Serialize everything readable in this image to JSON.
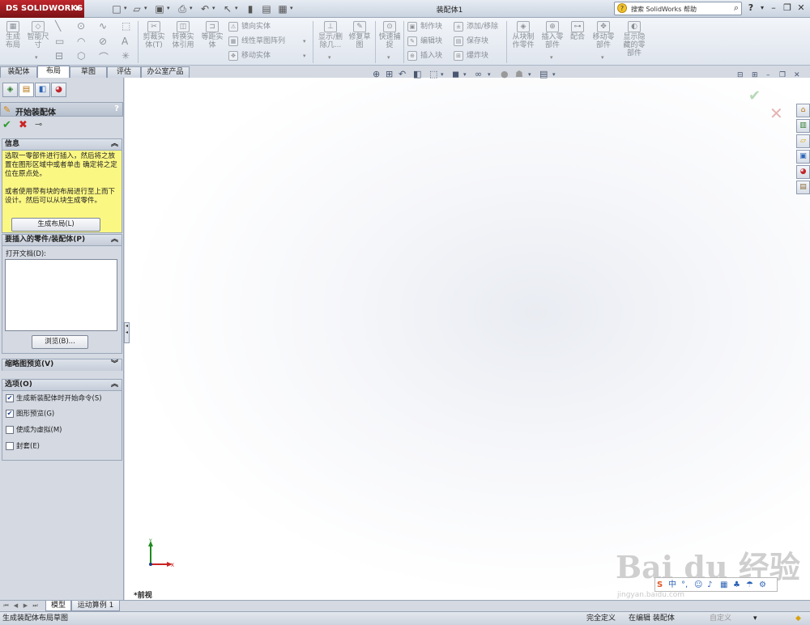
{
  "app": {
    "logo": "SOLIDWORKS",
    "logo_prefix": "DS",
    "doc_title": "装配体1",
    "search_placeholder": "搜索 SolidWorks 帮助",
    "help_icon": "?"
  },
  "ribbon": {
    "sketch": [
      {
        "label": "生成\n布局",
        "icon": "layout-icon"
      },
      {
        "label": "智能尺\n寸",
        "icon": "smart-dimension-icon"
      }
    ],
    "edit": [
      {
        "label": "剪裁实\n体(T)"
      },
      {
        "label": "转换实\n体引用"
      },
      {
        "label": "等距实\n体"
      }
    ],
    "edit_small": [
      {
        "label": "镜向实体"
      },
      {
        "label": "线性草图阵列"
      },
      {
        "label": "移动实体"
      }
    ],
    "display": [
      {
        "label": "显示/删\n除几..."
      },
      {
        "label": "修复草\n图"
      },
      {
        "label": "快速捕\n捉"
      }
    ],
    "block_small": [
      {
        "label": "制作块"
      },
      {
        "label": "编辑块"
      },
      {
        "label": "插入块"
      }
    ],
    "block_small2": [
      {
        "label": "添加/移除"
      },
      {
        "label": "保存块"
      },
      {
        "label": "爆炸块"
      }
    ],
    "assembly": [
      {
        "label": "从块制\n作零件"
      },
      {
        "label": "插入零\n部件"
      },
      {
        "label": "配合"
      },
      {
        "label": "移动零\n部件"
      },
      {
        "label": "显示隐\n藏的零\n部件"
      }
    ]
  },
  "tabs": [
    {
      "label": "装配体"
    },
    {
      "label": "布局"
    },
    {
      "label": "草图"
    },
    {
      "label": "评估"
    },
    {
      "label": "办公室产品"
    }
  ],
  "property_manager": {
    "title": "开始装配体",
    "help": "?",
    "info_header": "信息",
    "info_text_1": "选取一零部件进行插入，然后将之放置在图形区域中或者单击 确定将之定位在原点处。",
    "info_text_2": "或者使用带有块的布局进行至上而下设计。然后可以从块生成零件。",
    "create_layout_button": "生成布局(L)",
    "insert_header": "要插入的零件/装配体(P)",
    "open_doc_label": "打开文档(D):",
    "browse_button": "浏览(B)...",
    "thumbnail_header": "缩略图预览(V)",
    "options_header": "选项(O)",
    "options": [
      {
        "label": "生成新装配体时开始命令(S)",
        "checked": true
      },
      {
        "label": "图形预览(G)",
        "checked": true
      },
      {
        "label": "使成为虚拟(M)",
        "checked": false
      },
      {
        "label": "封套(E)",
        "checked": false
      }
    ]
  },
  "graphics": {
    "view_label": "*前视",
    "triad_x": "X",
    "triad_y": "Y"
  },
  "watermark": {
    "brand": "Bai du 经验",
    "url": "jingyan.baidu.com"
  },
  "bottom_tabs": [
    {
      "label": "模型"
    },
    {
      "label": "运动算例 1"
    }
  ],
  "status": {
    "message": "生成装配体布局草图",
    "state": "完全定义",
    "editing": "在编辑 装配体",
    "custom": "自定义"
  },
  "colors": {
    "info_bg": "#fbf783",
    "ok_green": "#2e9b2e",
    "cancel_red": "#cc2222",
    "logo_red": "#c0272d"
  }
}
